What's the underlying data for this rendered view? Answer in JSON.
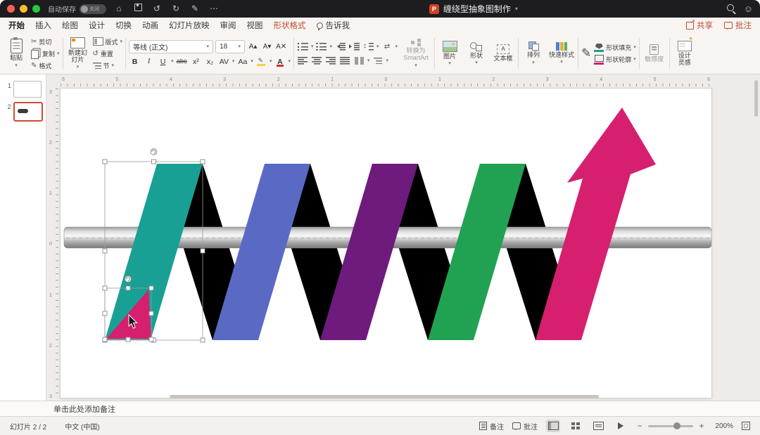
{
  "titlebar": {
    "autosave_label": "自动保存",
    "autosave_state": "关闭",
    "doc_title": "缠绕型抽象图制作"
  },
  "icons": {
    "home": "⌂",
    "undo": "↺",
    "redo": "↻",
    "pen": "✎",
    "more": "⋯",
    "smiley": "☺",
    "title_chevron": "▾"
  },
  "tabs": {
    "items": [
      "开始",
      "插入",
      "绘图",
      "设计",
      "切换",
      "动画",
      "幻灯片放映",
      "审阅",
      "视图",
      "形状格式",
      "告诉我"
    ],
    "share_label": "共享",
    "comments_label": "批注"
  },
  "ribbon": {
    "paste_label": "粘贴",
    "cut_label": "剪切",
    "copy_label": "复制",
    "format_painter_label": "格式",
    "new_slide_label": "新建幻灯片",
    "layout_label": "版式",
    "reset_label": "重置",
    "section_label": "节",
    "font_name": "等线 (正文)",
    "font_size": "18",
    "grow_font": "A▴",
    "shrink_font": "A▾",
    "clear_format": "A✕",
    "bold": "B",
    "italic": "I",
    "underline": "U",
    "strikethrough": "abc",
    "superscript": "x²",
    "subscript": "x₂",
    "kerning": "AV",
    "change_case": "Aa",
    "font_color": "A",
    "smartart_label": "转换为 SmartArt",
    "picture_label": "图片",
    "shapes_label": "形状",
    "textbox_label": "文本框",
    "arrange_label": "排列",
    "quick_styles_label": "快速样式",
    "shape_fill_label": "形状填充",
    "shape_outline_label": "形状轮廓",
    "sensitivity_label": "敏感度",
    "design_ideas_label": "设计灵感"
  },
  "slide_panel": {
    "slide1_num": "1",
    "slide2_num": "2"
  },
  "rulers": {
    "h": [
      "6",
      "5",
      "4",
      "3",
      "2",
      "1",
      "0",
      "1",
      "2",
      "3",
      "4",
      "5",
      "6"
    ],
    "v": [
      "3",
      "2",
      "1",
      "0",
      "1",
      "2",
      "3"
    ]
  },
  "graphic": {
    "back_color": "#000000",
    "bar_color_light": "#f8f8f8",
    "bar_color_dark": "#787878",
    "ribbons": [
      {
        "name": "teal",
        "color": "#19a095"
      },
      {
        "name": "blue",
        "color": "#5a6ac4"
      },
      {
        "name": "purple",
        "color": "#6e1b7d"
      },
      {
        "name": "green",
        "color": "#21a253"
      },
      {
        "name": "pink-arrow",
        "color": "#d6206f"
      }
    ],
    "triangle_color": "#d6206f"
  },
  "notes": {
    "placeholder": "单击此处添加备注"
  },
  "statusbar": {
    "slide_info": "幻灯片 2 / 2",
    "language": "中文 (中国)",
    "notes_label": "备注",
    "comments_label": "批注",
    "zoom_out": "−",
    "zoom_in": "+",
    "zoom_value": "200%"
  }
}
